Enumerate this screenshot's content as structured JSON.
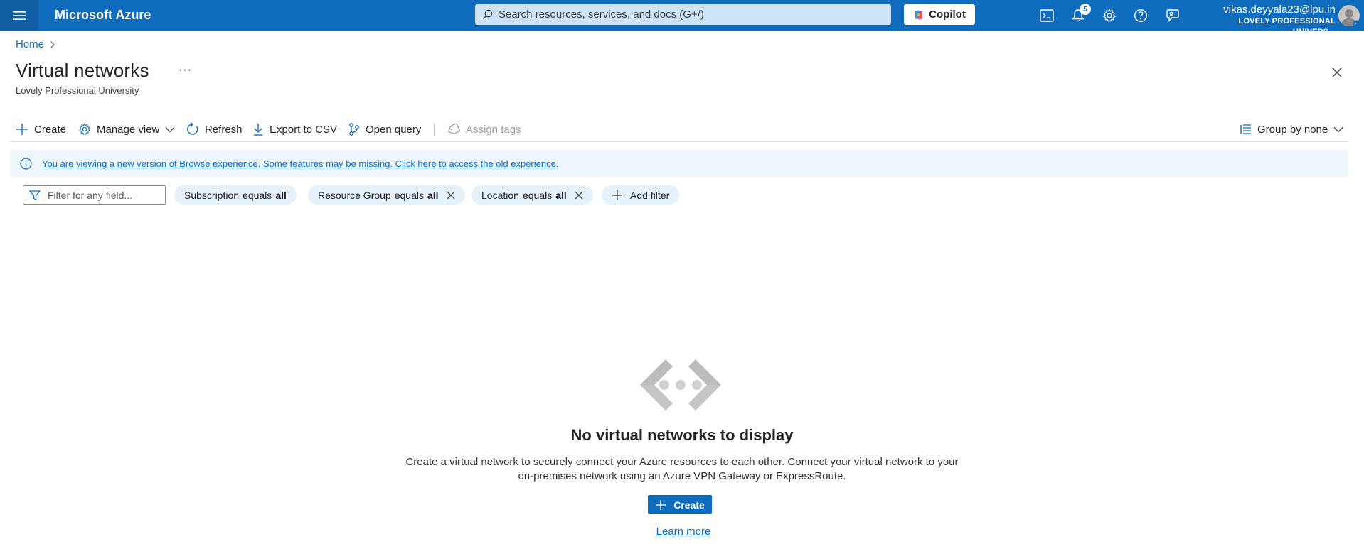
{
  "topbar": {
    "brand": "Microsoft Azure",
    "search_placeholder": "Search resources, services, and docs (G+/)",
    "copilot_label": "Copilot",
    "notification_count": "5",
    "account_email": "vikas.deyyala23@lpu.in",
    "account_org": "LOVELY PROFESSIONAL UNIVERS...",
    "icons": [
      "menu-icon",
      "search-icon",
      "copilot-icon",
      "cloud-shell-icon",
      "bell-icon",
      "gear-icon",
      "help-icon",
      "feedback-icon",
      "avatar-icon"
    ],
    "colors": {
      "bar": "#0f6cbd",
      "search": "#cde3f8"
    }
  },
  "breadcrumb": {
    "home": "Home"
  },
  "header": {
    "title": "Virtual networks",
    "more": "···",
    "subtitle": "Lovely Professional University"
  },
  "commandbar": {
    "create": "Create",
    "manage_view": "Manage view",
    "refresh": "Refresh",
    "export": "Export to CSV",
    "open_query": "Open query",
    "assign_tags": "Assign tags",
    "group_by": "Group by none"
  },
  "banner": {
    "text": "You are viewing a new version of Browse experience. Some features may be missing. Click here to access the old experience."
  },
  "filters": {
    "placeholder": "Filter for any field...",
    "equals": "equals",
    "all": "all",
    "subscription": "Subscription",
    "resource_group": "Resource Group",
    "location": "Location",
    "add_filter": "Add filter"
  },
  "empty_state": {
    "title": "No virtual networks to display",
    "description": "Create a virtual network to securely connect your Azure resources to each other. Connect your virtual network to your on-premises network using an Azure VPN Gateway or ExpressRoute.",
    "create": "Create",
    "learn_more": "Learn more"
  }
}
